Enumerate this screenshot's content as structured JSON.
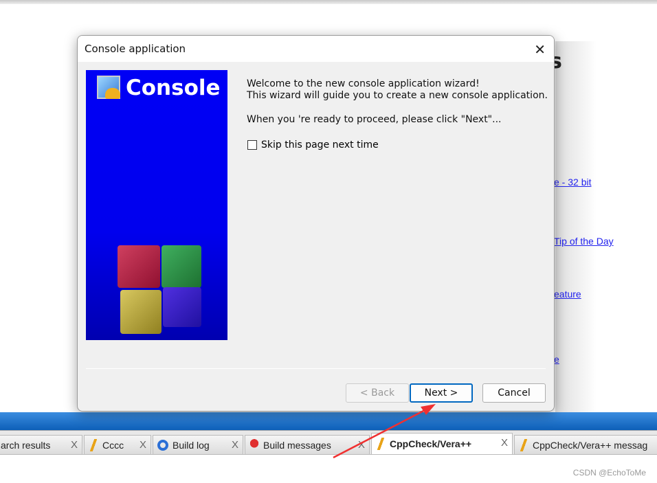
{
  "background": {
    "links": [
      "e - 32 bit",
      "Tip of the Day",
      "eature ",
      "e"
    ],
    "heading_fragment": "s"
  },
  "dialog": {
    "title": "Console application",
    "banner_title": "Console",
    "welcome_line1": "Welcome to the new console application wizard!",
    "welcome_line2": "This wizard will guide you to create a new console application.",
    "proceed_text": "When you 're ready to proceed, please click \"Next\"...",
    "skip_checkbox_label": "Skip this page next time",
    "skip_checked": false,
    "back_label": "< Back",
    "next_label": "Next >",
    "cancel_label": "Cancel"
  },
  "tabs": [
    {
      "label": "arch results",
      "icon": "none"
    },
    {
      "label": "Cccc",
      "icon": "pencil-icon"
    },
    {
      "label": "Build log",
      "icon": "gear-icon"
    },
    {
      "label": "Build messages",
      "icon": "pin-icon"
    },
    {
      "label": "CppCheck/Vera++",
      "icon": "pencil-icon",
      "active": true
    },
    {
      "label": "CppCheck/Vera++ messag",
      "icon": "pencil-icon"
    }
  ],
  "tab_close": "X",
  "watermark": "CSDN @EchoToMe",
  "colors": {
    "banner": "#0000f0",
    "annotation_arrow": "#f03030",
    "link": "#2222ee"
  }
}
